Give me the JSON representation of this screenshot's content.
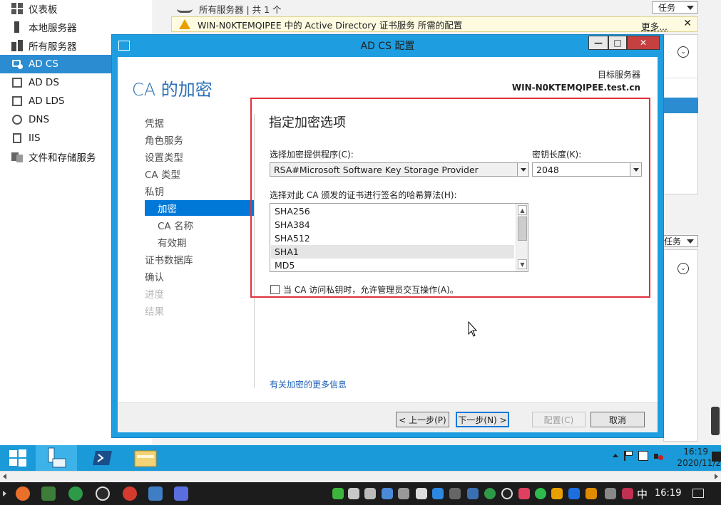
{
  "server_manager": {
    "nav": [
      {
        "label": "仪表板",
        "icon": "dashboard-icon"
      },
      {
        "label": "本地服务器",
        "icon": "server-icon"
      },
      {
        "label": "所有服务器",
        "icon": "servers-icon"
      },
      {
        "label": "AD CS",
        "icon": "adcs-icon",
        "active": true
      },
      {
        "label": "AD DS",
        "icon": "adds-icon"
      },
      {
        "label": "AD LDS",
        "icon": "adlds-icon"
      },
      {
        "label": "DNS",
        "icon": "dns-icon"
      },
      {
        "label": "IIS",
        "icon": "iis-icon"
      },
      {
        "label": "文件和存储服务",
        "icon": "storage-icon"
      }
    ],
    "header_subtitle": "所有服务器 | 共 1 个",
    "tasks_label": "任务",
    "tasks_label_2": "任务",
    "alert": {
      "text": "WIN-N0KTEMQIPEE 中的 Active Directory 证书服务 所需的配置",
      "more": "更多...",
      "close": "✕"
    }
  },
  "dialog": {
    "title": "AD CS 配置",
    "page_title": "CA 的加密",
    "target_label": "目标服务器",
    "target_name": "WIN-N0KTEMQIPEE.test.cn",
    "steps": [
      "凭据",
      "角色服务",
      "设置类型",
      "CA 类型",
      "私钥",
      "加密",
      "CA 名称",
      "有效期",
      "证书数据库",
      "确认",
      "进度",
      "结果"
    ],
    "section_title": "指定加密选项",
    "provider_label": "选择加密提供程序(C):",
    "provider_value": "RSA#Microsoft Software Key Storage Provider",
    "keylen_label": "密钥长度(K):",
    "keylen_value": "2048",
    "hash_label": "选择对此 CA 颁发的证书进行签名的哈希算法(H):",
    "hash_options": [
      "SHA256",
      "SHA384",
      "SHA512",
      "SHA1",
      "MD5"
    ],
    "hash_selected": "SHA1",
    "admin_interaction_label": "当 CA 访问私钥时，允许管理员交互操作(A)。",
    "admin_interaction_checked": false,
    "more_info": "有关加密的更多信息",
    "buttons": {
      "prev": "< 上一步(P)",
      "next": "下一步(N) >",
      "configure": "配置(C)",
      "cancel": "取消"
    }
  },
  "inner_taskbar": {
    "time": "16:19",
    "date": "2020/11/2"
  },
  "host_taskbar": {
    "ime": "中",
    "time": "16:19"
  }
}
